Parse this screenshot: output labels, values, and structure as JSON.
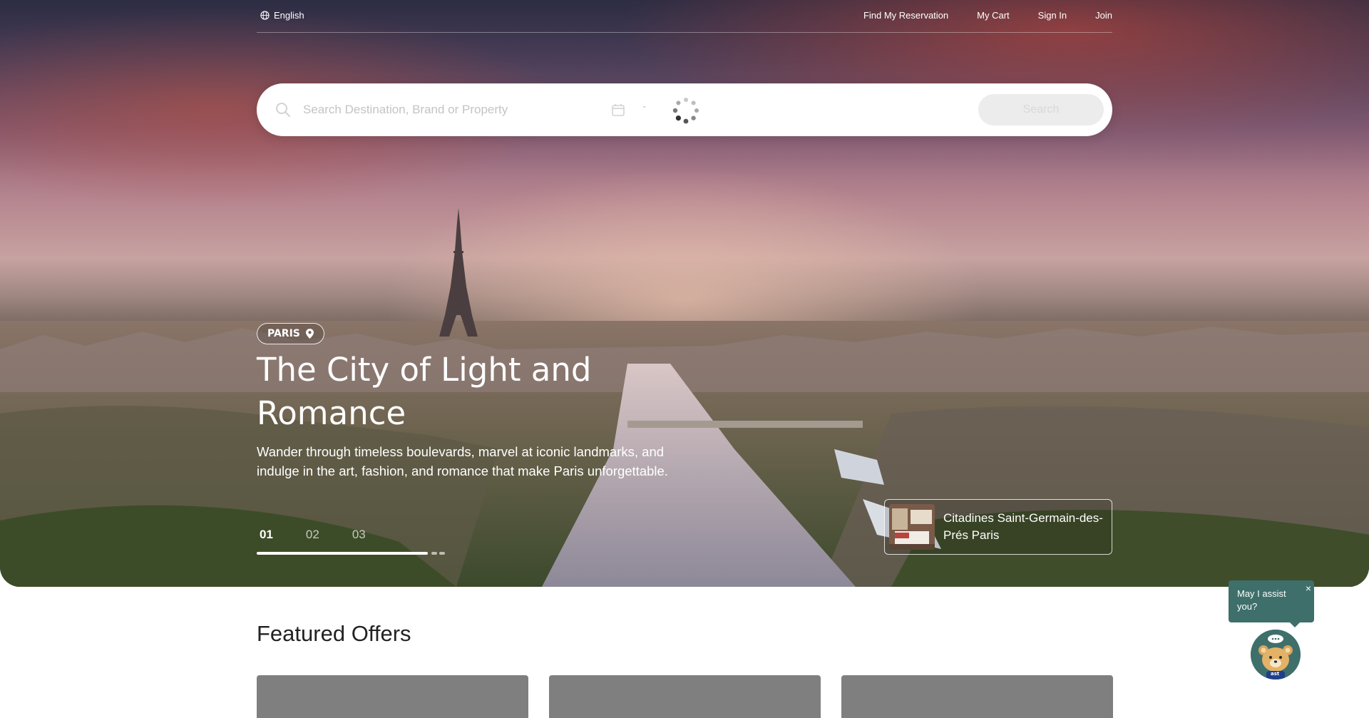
{
  "topbar": {
    "language": "English",
    "nav": {
      "find_reservation": "Find My Reservation",
      "cart": "My Cart",
      "sign_in": "Sign In",
      "join": "Join"
    }
  },
  "search": {
    "placeholder": "Search Destination, Brand or Property",
    "date_separator": "-",
    "button": "Search"
  },
  "hero": {
    "location_badge": "PARIS",
    "title": "The City of Light and Romance",
    "subtitle": "Wander through timeless boulevards, marvel at iconic landmarks, and indulge in the art, fashion, and romance that make Paris unforgettable.",
    "slides": [
      "01",
      "02",
      "03"
    ],
    "active_slide": 0,
    "slide_progress": 0.9,
    "featured_hotel": "Citadines Saint-Germain-des-Prés Paris"
  },
  "featured": {
    "heading": "Featured Offers",
    "card_count": 3
  },
  "chat": {
    "prompt": "May I assist you?",
    "close": "×",
    "avatar_badge": "ast"
  },
  "colors": {
    "chat_teal": "#3e6f6b",
    "offer_card": "#7f7f7f"
  }
}
